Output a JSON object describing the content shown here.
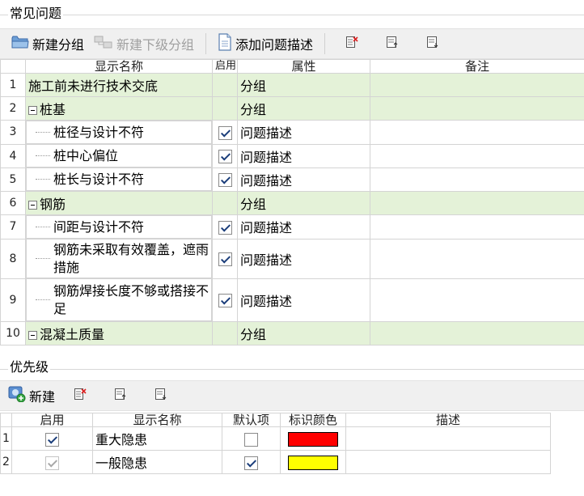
{
  "faq": {
    "title": "常见问题",
    "toolbar": {
      "new_group": "新建分组",
      "new_subgroup": "新建下级分组",
      "add_description": "添加问题描述"
    },
    "columns": {
      "name": "显示名称",
      "enabled": "启用",
      "attribute": "属性",
      "remark": "备注"
    },
    "rows": [
      {
        "num": "1",
        "name": "施工前未进行技术交底",
        "attr": "分组",
        "group": true,
        "expander": false,
        "checked": null,
        "remark": ""
      },
      {
        "num": "2",
        "name": "桩基",
        "attr": "分组",
        "group": true,
        "expander": true,
        "checked": null,
        "remark": ""
      },
      {
        "num": "3",
        "name": "桩径与设计不符",
        "attr": "问题描述",
        "group": false,
        "checked": true,
        "remark": ""
      },
      {
        "num": "4",
        "name": "桩中心偏位",
        "attr": "问题描述",
        "group": false,
        "checked": true,
        "remark": ""
      },
      {
        "num": "5",
        "name": "桩长与设计不符",
        "attr": "问题描述",
        "group": false,
        "checked": true,
        "remark": ""
      },
      {
        "num": "6",
        "name": "钢筋",
        "attr": "分组",
        "group": true,
        "expander": true,
        "checked": null,
        "remark": ""
      },
      {
        "num": "7",
        "name": "间距与设计不符",
        "attr": "问题描述",
        "group": false,
        "checked": true,
        "remark": ""
      },
      {
        "num": "8",
        "name": "钢筋未采取有效覆盖，遮雨措施",
        "attr": "问题描述",
        "group": false,
        "checked": true,
        "remark": ""
      },
      {
        "num": "9",
        "name": "钢筋焊接长度不够或搭接不足",
        "attr": "问题描述",
        "group": false,
        "checked": true,
        "remark": ""
      },
      {
        "num": "10",
        "name": "混凝土质量",
        "attr": "分组",
        "group": true,
        "expander": true,
        "checked": null,
        "remark": ""
      }
    ]
  },
  "priority": {
    "title": "优先级",
    "toolbar": {
      "new": "新建"
    },
    "columns": {
      "enabled": "启用",
      "name": "显示名称",
      "default": "默认项",
      "color": "标识颜色",
      "description": "描述"
    },
    "rows": [
      {
        "num": "1",
        "enabled": true,
        "enabled_dim": false,
        "name": "重大隐患",
        "default": false,
        "color": "#ff0000",
        "description": ""
      },
      {
        "num": "2",
        "enabled": true,
        "enabled_dim": true,
        "name": "一般隐患",
        "default": true,
        "color": "#ffff00",
        "description": ""
      }
    ]
  }
}
